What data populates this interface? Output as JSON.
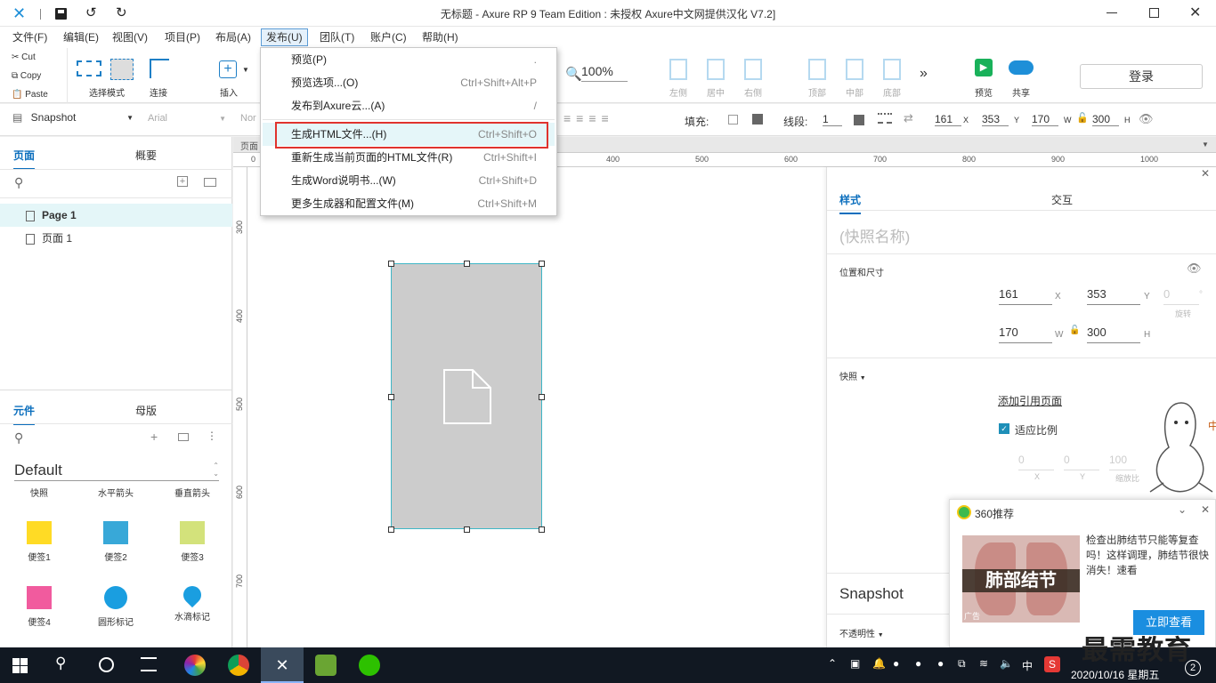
{
  "window": {
    "title": "无标题 - Axure RP 9 Team Edition : 未授权     Axure中文网提供汉化 V7.2]"
  },
  "menu": [
    "文件(F)",
    "编辑(E)",
    "视图(V)",
    "项目(P)",
    "布局(A)",
    "发布(U)",
    "团队(T)",
    "账户(C)",
    "帮助(H)"
  ],
  "clipboard": {
    "cut": "Cut",
    "copy": "Copy",
    "paste": "Paste"
  },
  "toolbar": {
    "select_mode": "选择模式",
    "connect": "连接",
    "insert": "插入",
    "zoom": "100%",
    "align_left": "左侧",
    "align_center": "居中",
    "align_right": "右侧",
    "align_top": "顶部",
    "align_middle": "中部",
    "align_bottom": "底部",
    "preview": "预览",
    "share": "共享",
    "login": "登录"
  },
  "format": {
    "style_name": "Snapshot",
    "font_name": "Arial",
    "font_style": "Nor",
    "fill_label": "填充:",
    "stroke_label": "线段:",
    "stroke_width": "1",
    "x": "161",
    "y": "353",
    "w": "170",
    "h": "300",
    "x_label": "X",
    "y_label": "Y",
    "w_label": "W",
    "h_label": "H"
  },
  "publish_menu": [
    {
      "label": "预览(P)",
      "shortcut": "."
    },
    {
      "label": "预览选项...(O)",
      "shortcut": "Ctrl+Shift+Alt+P"
    },
    {
      "label": "发布到Axure云...(A)",
      "shortcut": "/"
    },
    {
      "label": "生成HTML文件...(H)",
      "shortcut": "Ctrl+Shift+O"
    },
    {
      "label": "重新生成当前页面的HTML文件(R)",
      "shortcut": "Ctrl+Shift+I"
    },
    {
      "label": "生成Word说明书...(W)",
      "shortcut": "Ctrl+Shift+D"
    },
    {
      "label": "更多生成器和配置文件(M)",
      "shortcut": "Ctrl+Shift+M"
    }
  ],
  "pages_panel": {
    "tab_pages": "页面",
    "tab_outline": "概要",
    "pages": [
      "Page 1",
      "页面 1"
    ]
  },
  "library_panel": {
    "tab_widgets": "元件",
    "tab_masters": "母版",
    "library": "Default",
    "headers": [
      "快照",
      "水平箭头",
      "垂直箭头"
    ],
    "widgets": [
      "便签1",
      "便签2",
      "便签3",
      "便签4",
      "圆形标记",
      "水滴标记"
    ],
    "widget_colors": [
      "#ffdb25",
      "#38a8d8",
      "#d3e27b",
      "#f15b9e",
      "#1a9ee0",
      "#1a9ee0"
    ]
  },
  "ruler": {
    "h_page": "页面",
    "h_ticks": [
      "0",
      "400",
      "500",
      "600",
      "700",
      "800",
      "900",
      "1000"
    ],
    "v_ticks": [
      "300",
      "400",
      "500",
      "600",
      "700"
    ]
  },
  "inspector": {
    "tab_style": "样式",
    "tab_interact": "交互",
    "snapshot_name_placeholder": "(快照名称)",
    "section_position": "位置和尺寸",
    "x": "161",
    "y": "353",
    "rotation": "0",
    "rotation_label": "旋转",
    "w": "170",
    "h": "300",
    "x_label": "X",
    "y_label": "Y",
    "w_label": "W",
    "h_label": "H",
    "section_snapshot": "快照",
    "add_ref_page": "添加引用页面",
    "fit_scale": "适应比例",
    "offset_x": "0",
    "offset_y": "0",
    "scale": "100",
    "offset_x_label": "X",
    "offset_y_label": "Y",
    "scale_label": "缩放比",
    "style_title": "Snapshot",
    "opacity": "不透明性"
  },
  "popup": {
    "title": "360推荐",
    "text": "检查出肺结节只能等复查吗！这样调理，肺结节很快消失！速看",
    "image_caption": "肺部结节",
    "ad_label": "广告",
    "cta": "立即查看"
  },
  "watermark": "最需教育",
  "taskbar": {
    "date": "2020/10/16 星期五",
    "lang": "中",
    "badge": "2"
  }
}
